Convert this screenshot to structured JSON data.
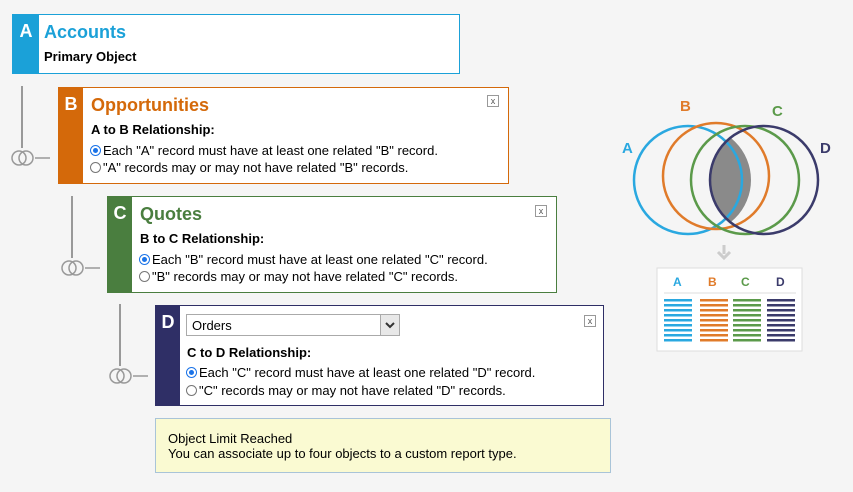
{
  "objects": [
    {
      "letter": "A",
      "title": "Accounts",
      "subtitle": "Primary Object",
      "color": "#1ba1d8"
    },
    {
      "letter": "B",
      "title": "Opportunities",
      "relationship": "A to B Relationship:",
      "close": "x",
      "options": [
        "Each \"A\" record must have at least one related \"B\" record.",
        "\"A\" records may or may not have related \"B\" records."
      ],
      "selected": 0,
      "color": "#d4690a"
    },
    {
      "letter": "C",
      "title": "Quotes",
      "relationship": "B to C Relationship:",
      "close": "x",
      "options": [
        "Each \"B\" record must have at least one related \"C\" record.",
        "\"B\" records may or may not have related \"C\" records."
      ],
      "selected": 0,
      "color": "#4a7e3f"
    },
    {
      "letter": "D",
      "select_value": "Orders",
      "relationship": "C to D Relationship:",
      "close": "x",
      "options": [
        "Each \"C\" record must have at least one related \"D\" record.",
        "\"C\" records may or may not have related \"D\" records."
      ],
      "selected": 0,
      "color": "#2f2f66"
    }
  ],
  "notice": {
    "title": "Object Limit Reached",
    "message": "You can associate up to four objects to a custom report type."
  },
  "diagram": {
    "labels": [
      "A",
      "B",
      "C",
      "D"
    ],
    "colors": {
      "A": "#2aa8e0",
      "B": "#e07b2a",
      "C": "#5b9a4a",
      "D": "#3b3b6b",
      "overlap": "#888888"
    }
  }
}
